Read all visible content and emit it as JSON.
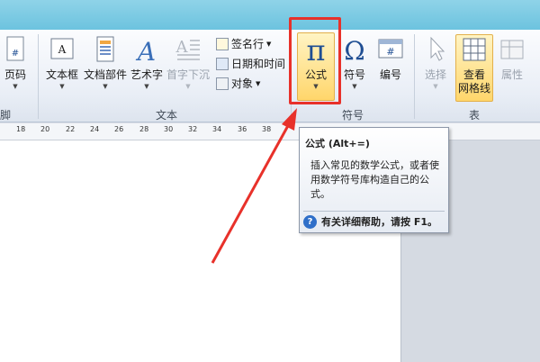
{
  "ribbon": {
    "left_partial": {
      "label": "页码",
      "group_label_fragment": "脚"
    },
    "text_group": {
      "label": "文本",
      "buttons": [
        {
          "label": "文本框"
        },
        {
          "label": "文档部件"
        },
        {
          "label": "艺术字"
        },
        {
          "label": "首字下沉"
        }
      ],
      "small_buttons": [
        {
          "label": "签名行"
        },
        {
          "label": "日期和时间"
        },
        {
          "label": "对象"
        }
      ]
    },
    "symbols_group": {
      "label": "符号",
      "buttons": [
        {
          "label": "公式",
          "icon": "pi-icon"
        },
        {
          "label": "符号",
          "icon": "omega-icon"
        },
        {
          "label": "编号",
          "icon": "hash-icon"
        }
      ]
    },
    "table_group": {
      "label": "表",
      "buttons": [
        {
          "label": "选择"
        },
        {
          "label": "查看\n网格线",
          "label_line1": "查看",
          "label_line2": "网格线"
        },
        {
          "label": "属性"
        }
      ]
    }
  },
  "ruler": {
    "numbers": [
      "18",
      "20",
      "22",
      "24",
      "26",
      "28",
      "30",
      "32",
      "34",
      "36",
      "38"
    ]
  },
  "tooltip": {
    "title": "公式 (Alt+=)",
    "body": "插入常见的数学公式，或者使用数学符号库构造自己的公式。",
    "help": "有关详细帮助，请按 F1。"
  },
  "colors": {
    "highlight": "#e8312a",
    "accent_blue": "#2f6fc9"
  }
}
